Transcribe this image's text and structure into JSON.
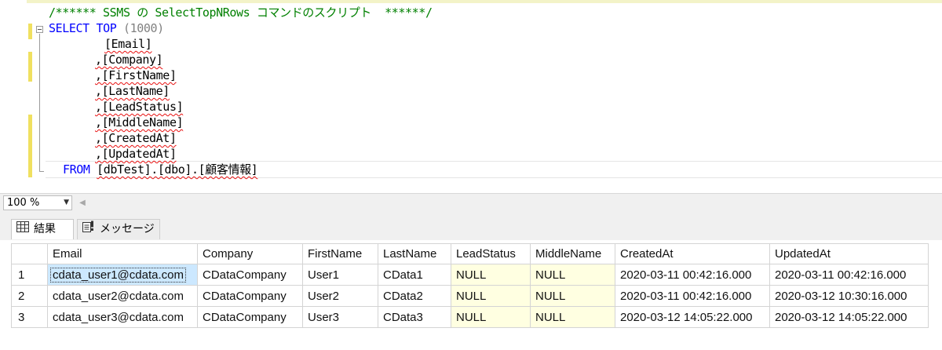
{
  "editor": {
    "comment": "/****** SSMS の SelectTopNRows コマンドのスクリプト  ******/",
    "select_kw": "SELECT",
    "top_kw": "TOP",
    "top_value": "(1000)",
    "columns": [
      "[Email]",
      ",[Company]",
      ",[FirstName]",
      ",[LastName]",
      ",[LeadStatus]",
      ",[MiddleName]",
      ",[CreatedAt]",
      ",[UpdatedAt]"
    ],
    "from_kw": "FROM",
    "from_target": "[dbTest].[dbo].[顧客情報]"
  },
  "zoom": {
    "value": "100 %"
  },
  "tabs": [
    {
      "label": "結果",
      "icon": "grid-icon"
    },
    {
      "label": "メッセージ",
      "icon": "message-icon"
    }
  ],
  "results": {
    "headers": [
      "Email",
      "Company",
      "FirstName",
      "LastName",
      "LeadStatus",
      "MiddleName",
      "CreatedAt",
      "UpdatedAt"
    ],
    "rows": [
      {
        "num": "1",
        "cells": [
          "cdata_user1@cdata.com",
          "CDataCompany",
          "User1",
          "CData1",
          "NULL",
          "NULL",
          "2020-03-11 00:42:16.000",
          "2020-03-11 00:42:16.000"
        ]
      },
      {
        "num": "2",
        "cells": [
          "cdata_user2@cdata.com",
          "CDataCompany",
          "User2",
          "CData2",
          "NULL",
          "NULL",
          "2020-03-11 00:42:16.000",
          "2020-03-12 10:30:16.000"
        ]
      },
      {
        "num": "3",
        "cells": [
          "cdata_user3@cdata.com",
          "CDataCompany",
          "User3",
          "CData3",
          "NULL",
          "NULL",
          "2020-03-12 14:05:22.000",
          "2020-03-12 14:05:22.000"
        ]
      }
    ]
  },
  "colors": {
    "keyword": "#0000ff",
    "comment": "#008000",
    "null_cell": "#ffffe1",
    "selection": "#cce8ff"
  }
}
